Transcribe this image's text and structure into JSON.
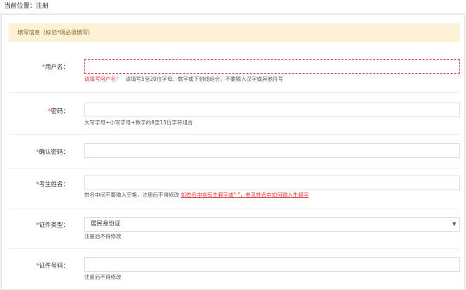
{
  "breadcrumb": {
    "label": "当前位置：",
    "current": "注册"
  },
  "notice": "填写信息（标记*项必须填写）",
  "fields": {
    "username": {
      "star": "*",
      "label": "用户名：",
      "value": "",
      "error": "请填写用户名！",
      "hint": "请填写5至20位字母、数字或下划线组合，不要输入汉字或其他符号"
    },
    "password": {
      "star": "*",
      "label": "密码：",
      "value": "",
      "hint": "大写字母+小写字母+数字的8至15位字符组合"
    },
    "confirm": {
      "star": "*",
      "label": "确认密码：",
      "value": ""
    },
    "name": {
      "star": "*",
      "label": "考生姓名：",
      "value": "",
      "hint": "姓名中间不要输入空格，注册后不得修改",
      "link": "如姓名中含有生僻字或\"·\"，参见姓名中如何输入生僻字"
    },
    "idtype": {
      "star": "*",
      "label": "证件类型：",
      "value": "居民身份证",
      "hint": "注册后不得修改"
    },
    "idnumber": {
      "star": "*",
      "label": "证件号码：",
      "value": "",
      "hint": "注册后不得修改"
    }
  },
  "icons": {
    "select_arrow": "chevron-down-icon"
  }
}
